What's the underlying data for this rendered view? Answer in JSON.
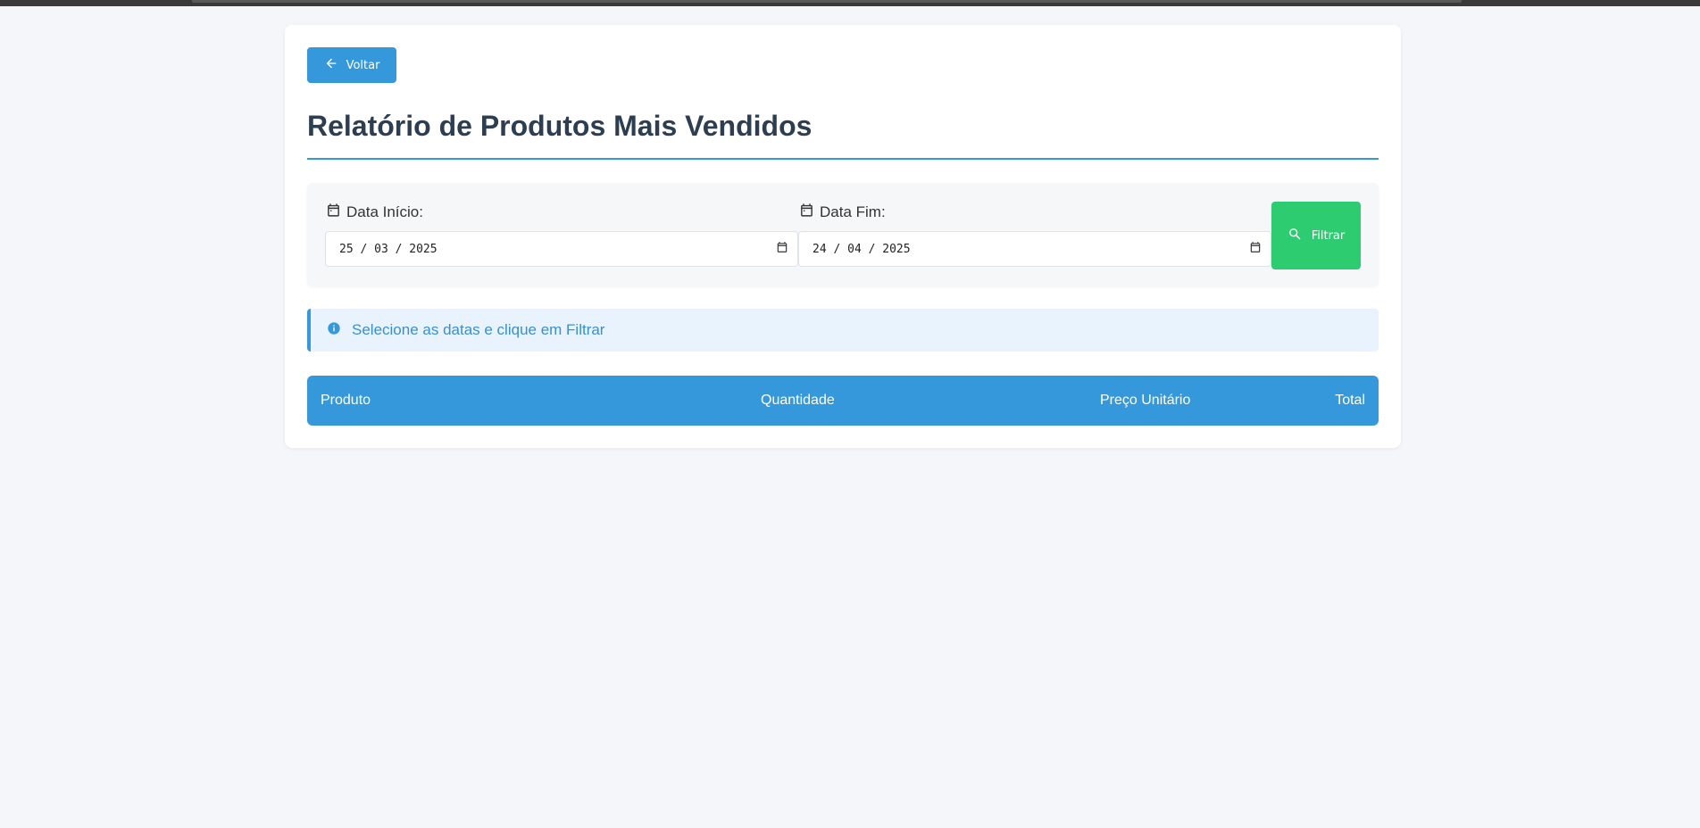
{
  "header": {
    "back_label": "Voltar",
    "title": "Relatório de Produtos Mais Vendidos"
  },
  "filters": {
    "start_label": "Data Início:",
    "start_value": "25 / 03 / 2025",
    "end_label": "Data Fim:",
    "end_value": "24 / 04 / 2025",
    "filter_label": "Filtrar"
  },
  "info": {
    "message": "Selecione as datas e clique em Filtrar"
  },
  "table": {
    "columns": [
      "Produto",
      "Quantidade",
      "Preço Unitário",
      "Total"
    ]
  },
  "icons": {
    "back": "arrow-left-icon",
    "calendar": "calendar-icon",
    "search": "search-icon",
    "info": "info-icon"
  },
  "colors": {
    "primary": "#3498db",
    "success": "#2ecc71",
    "background": "#f4f6f9",
    "title": "#2c3e50",
    "info_bg": "#e8f3fd"
  }
}
